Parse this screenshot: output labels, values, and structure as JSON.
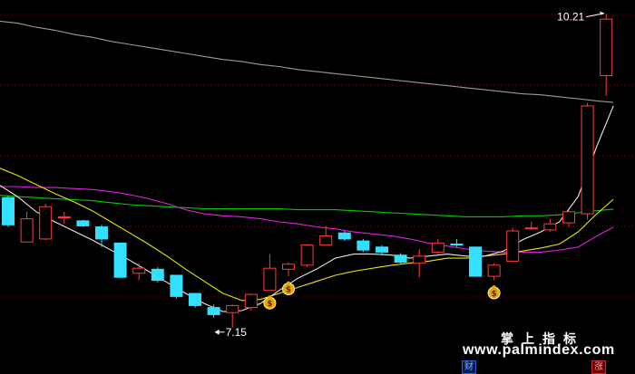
{
  "chart_data": {
    "type": "candlestick",
    "title": "",
    "ylim": [
      6.7,
      10.4
    ],
    "grid": true,
    "colors": {
      "background": "#000000",
      "up": "#ff3c3c",
      "down": "#33e0ff",
      "ma_white": "#e8e8e8",
      "ma_yellow": "#e6e600",
      "ma_magenta": "#e020e0",
      "ma_green": "#00cc00",
      "ma_gray": "#9a9a9a",
      "grid": "#7a1010"
    },
    "candles": [
      {
        "o": 8.44,
        "c": 8.17,
        "h": 8.46,
        "l": 8.15
      },
      {
        "o": 8.0,
        "c": 8.23,
        "h": 8.3,
        "l": 8.0
      },
      {
        "o": 8.03,
        "c": 8.35,
        "h": 8.38,
        "l": 8.02
      },
      {
        "o": 8.24,
        "c": 8.25,
        "h": 8.3,
        "l": 8.18
      },
      {
        "o": 8.21,
        "c": 8.16,
        "h": 8.22,
        "l": 8.15
      },
      {
        "o": 8.15,
        "c": 8.03,
        "h": 8.17,
        "l": 7.95
      },
      {
        "o": 7.99,
        "c": 7.65,
        "h": 7.99,
        "l": 7.65
      },
      {
        "o": 7.69,
        "c": 7.74,
        "h": 7.79,
        "l": 7.62
      },
      {
        "o": 7.73,
        "c": 7.62,
        "h": 7.75,
        "l": 7.6
      },
      {
        "o": 7.67,
        "c": 7.46,
        "h": 7.67,
        "l": 7.44
      },
      {
        "o": 7.49,
        "c": 7.37,
        "h": 7.49,
        "l": 7.35
      },
      {
        "o": 7.35,
        "c": 7.28,
        "h": 7.38,
        "l": 7.25
      },
      {
        "o": 7.3,
        "c": 7.37,
        "h": 7.38,
        "l": 7.15
      },
      {
        "o": 7.35,
        "c": 7.48,
        "h": 7.49,
        "l": 7.32
      },
      {
        "o": 7.52,
        "c": 7.74,
        "h": 7.88,
        "l": 7.52
      },
      {
        "o": 7.73,
        "c": 7.78,
        "h": 7.8,
        "l": 7.66
      },
      {
        "o": 7.77,
        "c": 7.97,
        "h": 7.98,
        "l": 7.75
      },
      {
        "o": 7.97,
        "c": 8.06,
        "h": 8.16,
        "l": 7.97
      },
      {
        "o": 8.09,
        "c": 8.03,
        "h": 8.11,
        "l": 8.01
      },
      {
        "o": 8.01,
        "c": 7.92,
        "h": 8.03,
        "l": 7.9
      },
      {
        "o": 7.95,
        "c": 7.9,
        "h": 7.97,
        "l": 7.88
      },
      {
        "o": 7.87,
        "c": 7.8,
        "h": 7.89,
        "l": 7.78
      },
      {
        "o": 7.79,
        "c": 7.86,
        "h": 7.93,
        "l": 7.65
      },
      {
        "o": 7.9,
        "c": 7.99,
        "h": 8.03,
        "l": 7.88
      },
      {
        "o": 7.98,
        "c": 7.97,
        "h": 8.03,
        "l": 7.95
      },
      {
        "o": 7.95,
        "c": 7.66,
        "h": 7.95,
        "l": 7.66
      },
      {
        "o": 7.66,
        "c": 7.77,
        "h": 7.79,
        "l": 7.62
      },
      {
        "o": 7.81,
        "c": 8.11,
        "h": 8.14,
        "l": 7.81
      },
      {
        "o": 8.13,
        "c": 8.14,
        "h": 8.2,
        "l": 8.12
      },
      {
        "o": 8.12,
        "c": 8.18,
        "h": 8.23,
        "l": 8.1
      },
      {
        "o": 8.19,
        "c": 8.3,
        "h": 8.32,
        "l": 8.15
      },
      {
        "o": 8.28,
        "c": 9.35,
        "h": 9.38,
        "l": 8.22
      },
      {
        "o": 9.65,
        "c": 10.21,
        "h": 10.26,
        "l": 9.45
      }
    ],
    "ma_lines": {
      "white": [
        8.62,
        8.45,
        8.3,
        8.2,
        8.11,
        8.02,
        7.92,
        7.82,
        7.71,
        7.6,
        7.49,
        7.39,
        7.31,
        7.32,
        7.39,
        7.52,
        7.64,
        7.73,
        7.84,
        7.88,
        7.88,
        7.87,
        7.84,
        7.86,
        7.88,
        7.86,
        7.86,
        7.91,
        8.02,
        8.1,
        8.2,
        8.45,
        8.95
      ],
      "yellow": [
        8.77,
        8.66,
        8.57,
        8.48,
        8.4,
        8.31,
        8.2,
        8.09,
        7.98,
        7.86,
        7.73,
        7.61,
        7.49,
        7.42,
        7.43,
        7.49,
        7.55,
        7.61,
        7.67,
        7.71,
        7.74,
        7.77,
        7.79,
        7.81,
        7.84,
        7.84,
        7.86,
        7.88,
        7.91,
        7.94,
        7.98,
        8.1,
        8.28
      ],
      "magenta": [
        8.55,
        8.55,
        8.54,
        8.54,
        8.53,
        8.52,
        8.5,
        8.47,
        8.43,
        8.38,
        8.32,
        8.28,
        8.26,
        8.25,
        8.23,
        8.2,
        8.18,
        8.15,
        8.13,
        8.1,
        8.08,
        8.06,
        8.03,
        7.99,
        7.96,
        7.93,
        7.91,
        7.9,
        7.9,
        7.9,
        7.92,
        7.95,
        8.06
      ],
      "green": [
        8.47,
        8.45,
        8.44,
        8.43,
        8.42,
        8.41,
        8.39,
        8.37,
        8.36,
        8.35,
        8.34,
        8.33,
        8.33,
        8.33,
        8.33,
        8.33,
        8.32,
        8.32,
        8.32,
        8.31,
        8.3,
        8.29,
        8.28,
        8.27,
        8.26,
        8.25,
        8.25,
        8.25,
        8.26,
        8.26,
        8.27,
        8.29,
        8.31
      ],
      "gray": [
        10.2,
        10.17,
        10.13,
        10.1,
        10.06,
        10.03,
        9.99,
        9.96,
        9.93,
        9.9,
        9.87,
        9.84,
        9.81,
        9.79,
        9.76,
        9.74,
        9.71,
        9.69,
        9.67,
        9.65,
        9.63,
        9.61,
        9.59,
        9.57,
        9.55,
        9.53,
        9.51,
        9.49,
        9.47,
        9.46,
        9.44,
        9.42,
        9.4
      ]
    },
    "annotations": {
      "max_label": "10.21",
      "min_label": "7.15",
      "max_index": 32,
      "min_index": 11
    },
    "money_bag_icons": [
      14,
      15,
      26
    ],
    "watermark": {
      "title": "掌上指标",
      "url": "www.palmindex.com"
    },
    "tags": {
      "cai": "财",
      "zhang": "涨"
    }
  }
}
